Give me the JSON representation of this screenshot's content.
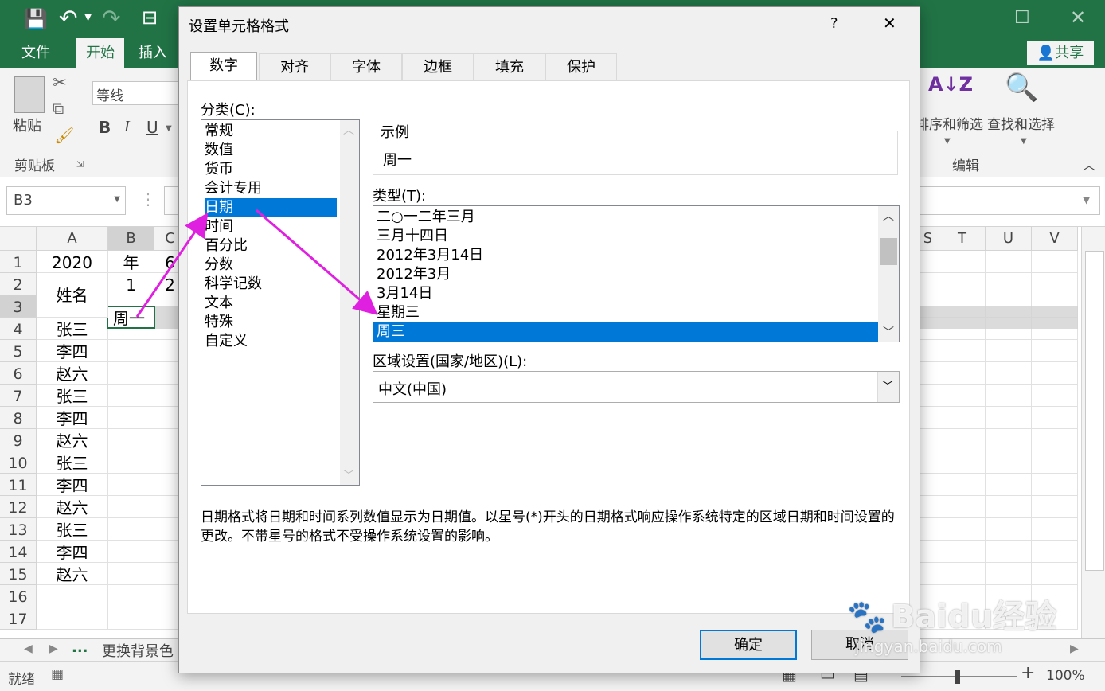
{
  "window": {
    "ribbon_tabs": [
      "文件",
      "开始",
      "插入"
    ],
    "share_label": "共享",
    "font_name": "等线",
    "paste_label": "粘贴",
    "clipboard_label": "剪贴板",
    "bold": "B",
    "italic": "I",
    "underline": "U",
    "sort_filter_label": "排序和筛选",
    "find_select_label": "查找和选择",
    "editing_label": "编辑",
    "name_box": "B3"
  },
  "sheet": {
    "left_columns": [
      "A",
      "B",
      "C"
    ],
    "right_columns": [
      "S",
      "T",
      "U",
      "V"
    ],
    "rows": [
      "1",
      "2",
      "3",
      "4",
      "5",
      "6",
      "7",
      "8",
      "9",
      "10",
      "11",
      "12",
      "13",
      "14",
      "15",
      "16",
      "17"
    ],
    "col_a": [
      "2020",
      "姓名",
      "",
      "张三",
      "李四",
      "赵六",
      "张三",
      "李四",
      "赵六",
      "张三",
      "李四",
      "赵六",
      "张三",
      "李四",
      "赵六",
      "",
      ""
    ],
    "col_b": [
      "年",
      "1",
      "周一",
      "",
      "",
      "",
      "",
      "",
      "",
      "",
      "",
      "",
      "",
      "",
      "",
      "",
      ""
    ],
    "col_c": [
      "6",
      "2",
      "",
      "",
      "",
      "",
      "",
      "",
      "",
      "",
      "",
      "",
      "",
      "",
      "",
      "",
      ""
    ],
    "sheet_tab": "更换背景色",
    "more": "..."
  },
  "status": {
    "ready": "就绪",
    "zoom": "100%"
  },
  "dialog": {
    "title": "设置单元格格式",
    "help": "?",
    "close": "✕",
    "tabs": [
      "数字",
      "对齐",
      "字体",
      "边框",
      "填充",
      "保护"
    ],
    "category_label": "分类(C):",
    "categories": [
      "常规",
      "数值",
      "货币",
      "会计专用",
      "日期",
      "时间",
      "百分比",
      "分数",
      "科学记数",
      "文本",
      "特殊",
      "自定义"
    ],
    "selected_category_index": 4,
    "sample_label": "示例",
    "sample_value": "周一",
    "type_label": "类型(T):",
    "types": [
      "二○一二年三月",
      "三月十四日",
      "2012年3月14日",
      "2012年3月",
      "3月14日",
      "星期三",
      "周三"
    ],
    "selected_type_index": 6,
    "locale_label": "区域设置(国家/地区)(L):",
    "locale_value": "中文(中国)",
    "description": "日期格式将日期和时间系列数值显示为日期值。以星号(*)开头的日期格式响应操作系统特定的区域日期和时间设置的更改。不带星号的格式不受操作系统设置的影响。",
    "ok_label": "确定",
    "cancel_label": "取消"
  },
  "watermark": "Baidu经验",
  "watermark_url": "jingyan.baidu.com",
  "colors": {
    "excel_green": "#217346",
    "selection_blue": "#0078d7",
    "arrow_magenta": "#e020e0"
  }
}
